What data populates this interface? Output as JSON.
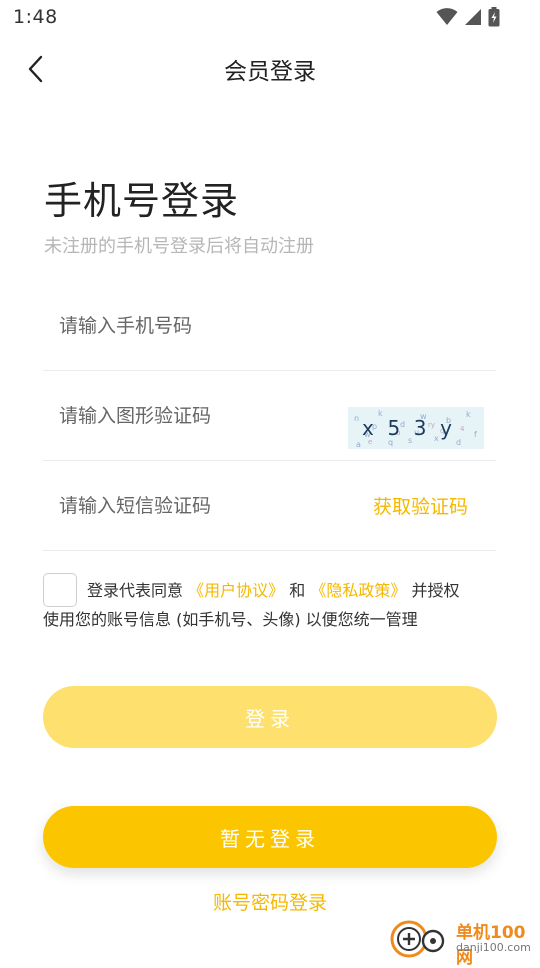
{
  "status_bar": {
    "time": "1:48"
  },
  "header": {
    "title": "会员登录"
  },
  "headline": {
    "title": "手机号登录",
    "subtitle": "未注册的手机号登录后将自动注册"
  },
  "form": {
    "phone_placeholder": "请输入手机号码",
    "captcha_placeholder": "请输入图形验证码",
    "captcha_text": "x53y",
    "sms_placeholder": "请输入短信验证码",
    "get_code_label": "获取验证码"
  },
  "agreement": {
    "prefix": "登录代表同意",
    "user_agreement": "《用户协议》",
    "and": "和",
    "privacy_policy": "《隐私政策》",
    "authorize": "并授权",
    "line2": "使用您的账号信息 (如手机号、头像) 以便您统一管理"
  },
  "buttons": {
    "login": "登录",
    "skip_login": "暂无登录",
    "password_login": "账号密码登录"
  },
  "watermark": {
    "name": "单机100网",
    "url": "danji100.com"
  },
  "colors": {
    "accent": "#fbc600",
    "accent_light": "#fde06e",
    "link": "#f5b800"
  }
}
